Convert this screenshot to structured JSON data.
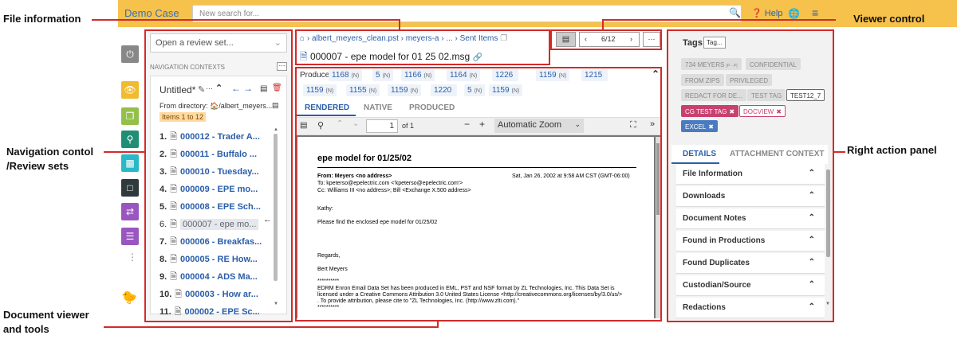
{
  "app": {
    "brand": "Demo Case",
    "search_placeholder": "New search for...",
    "help": "Help"
  },
  "annotations": {
    "file_info": "File information",
    "viewer_control": "Viewer control",
    "nav_line1": "Navigation contol",
    "nav_line2": "/Review sets",
    "right_panel": "Right action panel",
    "doc_line1": "Document viewer",
    "doc_line2": "and tools"
  },
  "left": {
    "review_placeholder": "Open a review set...",
    "nav_contexts": "NAVIGATION CONTEXTS",
    "context_title": "Untitled*",
    "from_dir": "From directory: 🏠/albert_meyers...",
    "items_badge": "Items 1 to 12",
    "rows": [
      {
        "n": "1.",
        "t": "000012 - Trader A..."
      },
      {
        "n": "2.",
        "t": "000011 - Buffalo ..."
      },
      {
        "n": "3.",
        "t": "000010 - Tuesday..."
      },
      {
        "n": "4.",
        "t": "000009 - EPE mo..."
      },
      {
        "n": "5.",
        "t": "000008 - EPE Sch..."
      },
      {
        "n": "6.",
        "t": "000007 - epe mo..."
      },
      {
        "n": "7.",
        "t": "000006 - Breakfas..."
      },
      {
        "n": "8.",
        "t": "000005 - RE  How..."
      },
      {
        "n": "9.",
        "t": "000004 - ADS Ma..."
      },
      {
        "n": "10.",
        "t": "000003 - How ar..."
      },
      {
        "n": "11.",
        "t": "000002 - EPE Sc..."
      }
    ]
  },
  "breadcrumb": {
    "b1": "albert_meyers_clean.pst",
    "b2": "meyers-a",
    "b3": "...",
    "b4": "Sent Items"
  },
  "doc_title": "000007 - epe model for 01 25 02.msg",
  "viewer_ctrl": {
    "page": "6/12"
  },
  "produced": {
    "label": "Produced as:",
    "chips": [
      {
        "v": "1168",
        "s": "(N)"
      },
      {
        "v": "5",
        "s": "(N)"
      },
      {
        "v": "1166",
        "s": "(N)"
      },
      {
        "v": "1164",
        "s": "(N)"
      },
      {
        "v": "1226",
        "s": ""
      },
      {
        "v": "1159",
        "s": "(N)"
      },
      {
        "v": "1215",
        "s": ""
      },
      {
        "v": "1159",
        "s": "(N)"
      },
      {
        "v": "1155",
        "s": "(N)"
      },
      {
        "v": "1159",
        "s": "(N)"
      },
      {
        "v": "1220",
        "s": ""
      },
      {
        "v": "5",
        "s": "(N)"
      },
      {
        "v": "1159",
        "s": "(N)"
      }
    ]
  },
  "viewer_tabs": {
    "rendered": "RENDERED",
    "native": "NATIVE",
    "produced": "PRODUCED"
  },
  "pdf": {
    "page": "1",
    "of": "of 1",
    "zoom": "Automatic Zoom"
  },
  "email": {
    "title": "epe model for 01/25/02",
    "from": "From: Meyers <no address>",
    "date": "Sat, Jan 26, 2002 at 9:58 AM CST (GMT-06:00)",
    "to": "To: kpeterso@epelectric.com <'kpeterso@epelectric.com'>",
    "cc": "Cc: Williams III <no address>; Bill <Exchange X.500 address>",
    "greet": "Kathy:",
    "body": "Please find the enclosed epe model for 01/25/02",
    "regards": "Regards,",
    "sign": "Bert Meyers",
    "stars": "**********",
    "f1": "EDRM Enron Email Data Set has been produced in EML, PST and NSF format by ZL Technologies, Inc. This Data Set is",
    "f2": "licensed under a Creative Commons Attribution 3.0 United States License <http://creativecommons.org/licenses/by/3.0/us/>",
    "f3": ". To provide attribution, please cite to \"ZL Technologies, Inc. (http://www.zlti.com).\"",
    "f4": "**********"
  },
  "right": {
    "tags_label": "Tags",
    "tag_btn": "Tag...",
    "tags": [
      "734 MEYERS",
      "CONFIDENTIAL",
      "FROM ZIPS",
      "PRIVILEGED",
      "REDACT FOR DE...",
      "TEST TAG",
      "TEST12_7",
      "CG TEST TAG",
      "DOCVIEW",
      "EXCEL"
    ],
    "tag_sub": "(P - P)",
    "tab_details": "DETAILS",
    "tab_attach": "ATTACHMENT CONTEXT",
    "sections": [
      "File Information",
      "Downloads",
      "Document Notes",
      "Found in Productions",
      "Found Duplicates",
      "Custodian/Source",
      "Redactions"
    ]
  },
  "colors": {
    "topbar": "#f6c24c",
    "annotation": "#d42a2a",
    "link": "#2a5ea8"
  }
}
